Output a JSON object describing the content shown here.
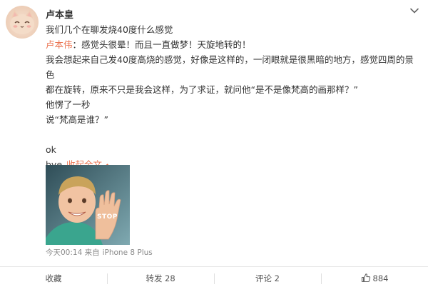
{
  "post": {
    "author": "卢本皇",
    "lines": [
      "我们几个在聊发烧40度什么感觉"
    ],
    "quote": {
      "author": "卢本伟",
      "text": "：感觉头很晕！而且一直做梦！天旋地转的！"
    },
    "body": [
      "我会想起来自己发40度高烧的感觉，好像是这样的，一闭眼就是很黑暗的地方，感觉四周的景色",
      "都在旋转，原来不只是我会这样，为了求证，就问他“是不是像梵高的画那样？”",
      "他愣了一秒",
      "说“梵高是谁？”"
    ],
    "tail": [
      "ok",
      "bye"
    ],
    "collapse_label": "收起全文",
    "image_stamp": "STOP",
    "timestamp": "今天00:14 来自",
    "device": "iPhone 8 Plus"
  },
  "actions": {
    "collect": "收藏",
    "repost": "转发 28",
    "comment": "评论 2",
    "like": "884"
  },
  "icons": {
    "more": "chevron-down-icon",
    "collapse": "chevron-up-icon",
    "like": "thumbs-up-icon"
  },
  "colors": {
    "accent": "#eb7350",
    "text": "#333333",
    "meta": "#8a8a8a"
  }
}
